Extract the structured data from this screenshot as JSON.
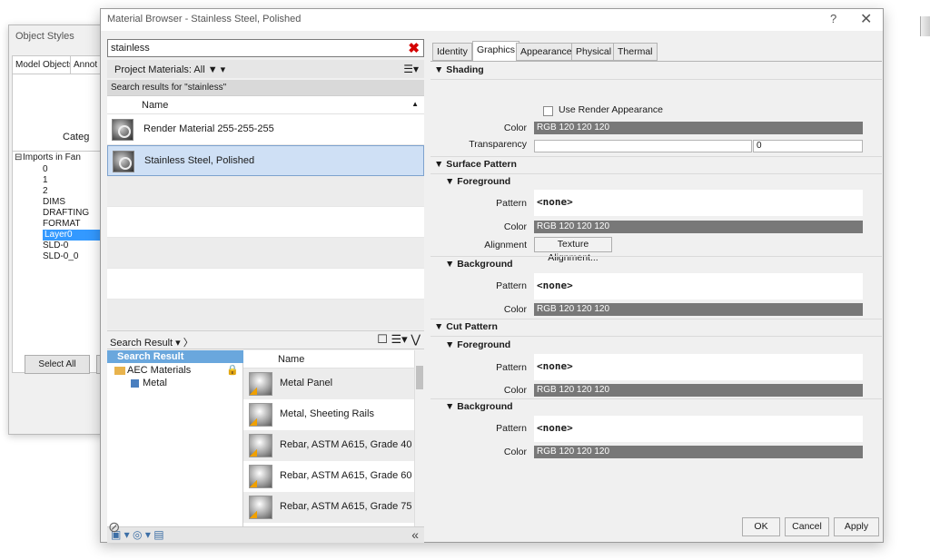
{
  "object_styles": {
    "title": "Object Styles",
    "tabs": [
      "Model Objects",
      "Annot"
    ],
    "category_header": "Categ",
    "tree": [
      "Imports in Fan",
      "0",
      "1",
      "2",
      "DIMS",
      "DRAFTING",
      "FORMAT",
      "Layer0",
      "SLD-0",
      "SLD-0_0"
    ],
    "tree_expand": "⊟",
    "selected_index": 7,
    "select_all": "Select All"
  },
  "dialog": {
    "title": "Material Browser - Stainless Steel, Polished",
    "help": "?",
    "close": "✕"
  },
  "search": {
    "value": "stainless",
    "clear": "✖"
  },
  "project": {
    "label": "Project Materials: All ▼ ▾",
    "view_icon": "☰▾",
    "results_label": "Search results for \"stainless\"",
    "name_header": "Name",
    "sort_icon": "▲",
    "materials": [
      "Render Material 255-255-255",
      "Stainless Steel, Polished"
    ],
    "selected_index": 1
  },
  "library": {
    "bar_label": "Search Result ▾ 〉",
    "bar_icons": "☐ ☰▾ ⋁",
    "tree_root": "Search Result",
    "tree_folder": "AEC Materials",
    "tree_child": "Metal",
    "lock": "🔒",
    "name_header": "Name",
    "items": [
      "Metal Panel",
      "Metal, Sheeting Rails",
      "Rebar, ASTM A615, Grade 40",
      "Rebar, ASTM A615, Grade 60",
      "Rebar, ASTM A615, Grade 75"
    ],
    "bottom_icons": "▣ ▾ ◎ ▾ ▤",
    "collapse": "«"
  },
  "tabs": [
    "Identity",
    "Graphics",
    "Appearance",
    "Physical",
    "Thermal"
  ],
  "active_tab": "Graphics",
  "graphics": {
    "shading_title": "▼ Shading",
    "use_render": "Use Render Appearance",
    "color_label": "Color",
    "color_value": "RGB 120 120 120",
    "transparency_label": "Transparency",
    "transparency_value": "0",
    "surface_title": "▼ Surface Pattern",
    "cut_title": "▼ Cut Pattern",
    "foreground": "▼ Foreground",
    "background": "▼ Background",
    "pattern_label": "Pattern",
    "pattern_value": "<none>",
    "alignment_label": "Alignment",
    "alignment_button": "Texture Alignment..."
  },
  "footer": {
    "ok": "OK",
    "cancel": "Cancel",
    "apply": "Apply",
    "no_icon": "⊘"
  },
  "colors": {
    "selection": "#cfe0f5",
    "swatch": "#787878",
    "tree_selected": "#3399ff"
  }
}
